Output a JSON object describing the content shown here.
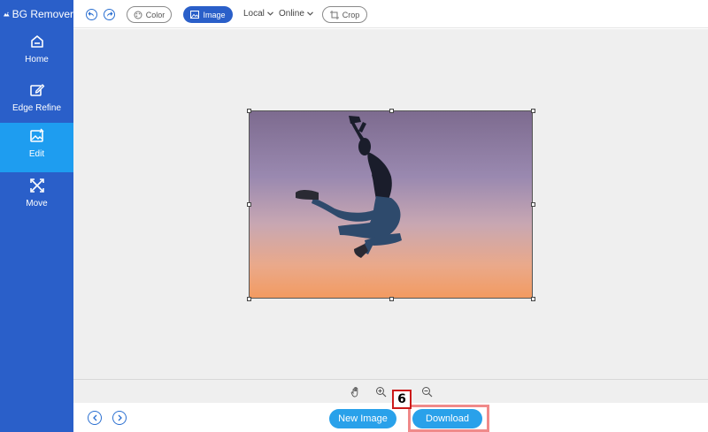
{
  "app": {
    "title": "BG Remover"
  },
  "sidebar": {
    "items": [
      {
        "label": "Home",
        "icon": "home-icon",
        "active": false
      },
      {
        "label": "Edge Refine",
        "icon": "edit-pencil-icon",
        "active": false
      },
      {
        "label": "Edit",
        "icon": "image-edit-icon",
        "active": true
      },
      {
        "label": "Move",
        "icon": "move-arrows-icon",
        "active": false
      }
    ]
  },
  "toolbar": {
    "color_label": "Color",
    "image_label": "Image",
    "local_label": "Local",
    "online_label": "Online",
    "crop_label": "Crop"
  },
  "bottom": {
    "new_image_label": "New Image",
    "download_label": "Download"
  },
  "annotation": {
    "step_number": "6"
  },
  "colors": {
    "sidebar_bg": "#2a5fc9",
    "sidebar_active": "#1e9df0",
    "accent_button": "#29a1ea",
    "highlight": "#f08a8a",
    "badge_border": "#cc1a1a"
  }
}
